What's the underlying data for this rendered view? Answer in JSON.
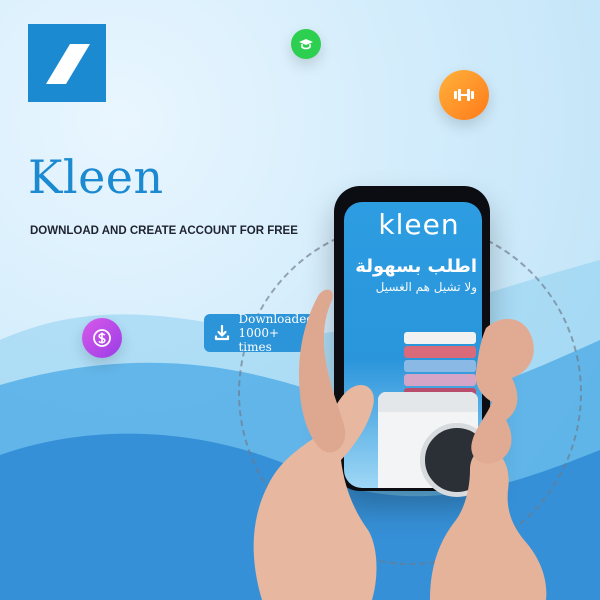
{
  "brand": {
    "name": "Kleen",
    "subtitle": "DOWNLOAD AND CREATE ACCOUNT FOR FREE"
  },
  "phone": {
    "app_logo_text": "kleen",
    "headline_ar": "اطلب بسهولة",
    "subline_ar": "ولا تشيل هم الغسيل"
  },
  "download_badge": {
    "line1": "Downloaded",
    "line2": "1000+ times"
  },
  "icons": {
    "logo": "stripe-logo-icon",
    "green": "graduation-icon",
    "orange": "dumbbell-icon",
    "purple": "dollar-icon",
    "download": "download-icon"
  },
  "colors": {
    "brand": "#1b8ad1",
    "text_dark": "#1f2330",
    "green": "#2ccf4f",
    "orange": "#ff7a1a",
    "purple": "#9a3ce6",
    "badge": "#2c94d8"
  }
}
